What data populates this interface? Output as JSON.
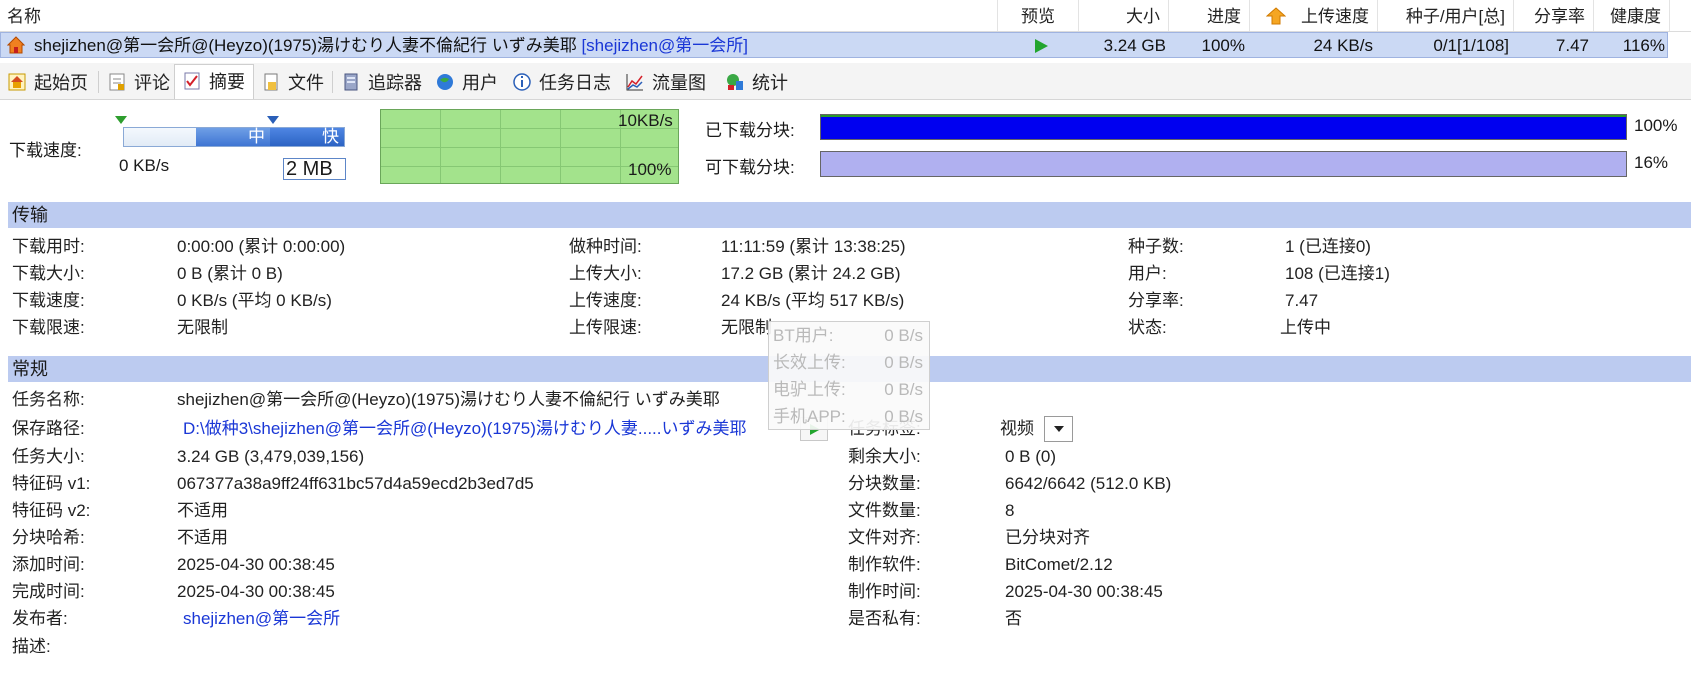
{
  "list": {
    "headers": {
      "name": "名称",
      "preview": "预览",
      "size": "大小",
      "progress": "进度",
      "upload_speed": "上传速度",
      "seeds_peers": "种子/用户[总]",
      "ratio": "分享率",
      "health": "健康度"
    },
    "row": {
      "name": "shejizhen@第一会所@(Heyzo)(1975)湯けむり人妻不倫紀行 いずみ美耶",
      "tag": "[shejizhen@第一会所]",
      "size": "3.24 GB",
      "progress": "100%",
      "upload_speed": "24 KB/s",
      "seeds_peers": "0/1[1/108]",
      "ratio": "7.47",
      "health": "116%"
    }
  },
  "tabs": [
    {
      "label": "起始页",
      "icon": "home-page-icon"
    },
    {
      "label": "评论",
      "icon": "comment-icon"
    },
    {
      "label": "摘要",
      "icon": "summary-icon"
    },
    {
      "label": "文件",
      "icon": "file-icon"
    },
    {
      "label": "追踪器",
      "icon": "tracker-icon"
    },
    {
      "label": "用户",
      "icon": "users-icon"
    },
    {
      "label": "任务日志",
      "icon": "info-icon"
    },
    {
      "label": "流量图",
      "icon": "chart-icon"
    },
    {
      "label": "统计",
      "icon": "stats-icon"
    }
  ],
  "speed": {
    "label": "下载速度:",
    "current": "0 KB/s",
    "limit_value": "2 MB",
    "slider_mid": "中",
    "slider_fast": "快",
    "graph_top": "10KB/s",
    "graph_bottom": "100%"
  },
  "pieces": {
    "downloaded_label": "已下载分块:",
    "downloaded_pct": "100%",
    "downloaded_fraction": 1.0,
    "available_label": "可下载分块:",
    "available_pct": "16%",
    "available_fraction": 1.0,
    "colors": {
      "downloaded": "#0000f0",
      "available": "#b0b0f0",
      "accent": "#2a9a2a"
    }
  },
  "transfer": {
    "title": "传输",
    "col1": [
      {
        "label": "下载用时:",
        "value": "0:00:00 (累计 0:00:00)"
      },
      {
        "label": "下载大小:",
        "value": "0 B (累计 0 B)"
      },
      {
        "label": "下载速度:",
        "value": "0 KB/s (平均 0 KB/s)"
      },
      {
        "label": "下载限速:",
        "value": "无限制"
      }
    ],
    "col2": [
      {
        "label": "做种时间:",
        "value": "11:11:59 (累计 13:38:25)"
      },
      {
        "label": "上传大小:",
        "value": "17.2 GB (累计 24.2 GB)"
      },
      {
        "label": "上传速度:",
        "value": "24 KB/s (平均 517 KB/s)"
      },
      {
        "label": "上传限速:",
        "value": "无限制"
      }
    ],
    "col3": [
      {
        "label": "种子数:",
        "value": "1 (已连接0)"
      },
      {
        "label": "用户:",
        "value": "108 (已连接1)"
      },
      {
        "label": "分享率:",
        "value": "7.47"
      },
      {
        "label": "状态:",
        "value": "上传中"
      }
    ]
  },
  "tooltip": [
    {
      "label": "BT用户:",
      "value": "0 B/s"
    },
    {
      "label": "长效上传:",
      "value": "0 B/s"
    },
    {
      "label": "电驴上传:",
      "value": "0 B/s"
    },
    {
      "label": "手机APP:",
      "value": "0 B/s"
    }
  ],
  "general": {
    "title": "常规",
    "task_name_label": "任务名称:",
    "task_name": "shejizhen@第一会所@(Heyzo)(1975)湯けむり人妻不倫紀行 いずみ美耶",
    "save_path_label": "保存路径:",
    "save_path": "D:\\做种3\\shejizhen@第一会所@(Heyzo)(1975)湯けむり人妻.....いずみ美耶",
    "left": [
      {
        "label": "任务大小:",
        "value": "3.24 GB (3,479,039,156)"
      },
      {
        "label": "特征码 v1:",
        "value": "067377a38a9ff24ff631bc57d4a59ecd2b3ed7d5"
      },
      {
        "label": "特征码 v2:",
        "value": "不适用"
      },
      {
        "label": "分块哈希:",
        "value": "不适用"
      },
      {
        "label": "添加时间:",
        "value": "2025-04-30 00:38:45"
      },
      {
        "label": "完成时间:",
        "value": "2025-04-30 00:38:45"
      }
    ],
    "publisher_label": "发布者:",
    "publisher": "shejizhen@第一会所",
    "description_label": "描述:",
    "task_tag_label": "任务标签:",
    "task_tag_value": "视频",
    "right": [
      {
        "label": "剩余大小:",
        "value": "0 B (0)"
      },
      {
        "label": "分块数量:",
        "value": "6642/6642 (512.0 KB)"
      },
      {
        "label": "文件数量:",
        "value": "8"
      },
      {
        "label": "文件对齐:",
        "value": "已分块对齐"
      },
      {
        "label": "制作软件:",
        "value": "BitComet/2.12"
      },
      {
        "label": "制作时间:",
        "value": "2025-04-30 00:38:45"
      },
      {
        "label": "是否私有:",
        "value": "否"
      }
    ]
  }
}
